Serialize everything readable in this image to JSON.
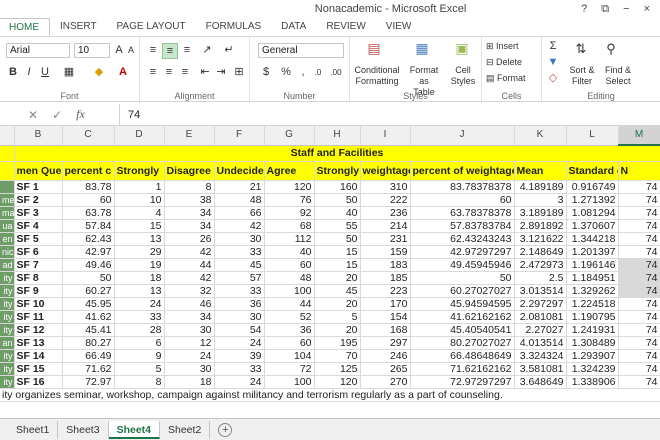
{
  "window": {
    "title": "Nonacademic - Microsoft Excel",
    "controls": [
      "?",
      "⧉",
      "−",
      "×"
    ]
  },
  "tabs": [
    "HOME",
    "INSERT",
    "PAGE LAYOUT",
    "FORMULAS",
    "DATA",
    "REVIEW",
    "VIEW"
  ],
  "ribbon": {
    "font_name": "Arial",
    "font_size": "10",
    "number_format": "General",
    "groups": [
      "Font",
      "Alignment",
      "Number",
      "Styles",
      "Cells",
      "Editing"
    ],
    "styles": {
      "conditional": "Conditional\nFormatting",
      "format_table": "Format as\nTable",
      "cell_styles": "Cell\nStyles"
    },
    "cells": {
      "insert": "Insert",
      "delete": "Delete",
      "format": "Format"
    },
    "editing": {
      "sort": "Sort &\nFilter",
      "find": "Find &\nSelect"
    }
  },
  "formula_bar": {
    "value": "74"
  },
  "columns": [
    "B",
    "C",
    "D",
    "E",
    "F",
    "G",
    "H",
    "I",
    "J",
    "K",
    "L",
    "M"
  ],
  "active_column": "M",
  "title_row": "Staff and Facilities",
  "header_row": [
    "men Question",
    "percent c",
    "Strongly",
    "Disagree",
    "Undecided",
    "Agree",
    "Strongly a",
    "weightage",
    "percent of weightage",
    "Mean",
    "Standard c",
    "N"
  ],
  "rows": [
    {
      "a": "",
      "cells": [
        "SF 1",
        "83.78",
        "1",
        "8",
        "21",
        "120",
        "160",
        "310",
        "83.78378378",
        "4.189189",
        "0.916749",
        "74"
      ]
    },
    {
      "a": "me",
      "cells": [
        "SF 2",
        "60",
        "10",
        "38",
        "48",
        "76",
        "50",
        "222",
        "60",
        "3",
        "1.271392",
        "74"
      ]
    },
    {
      "a": "ma",
      "cells": [
        "SF 3",
        "63.78",
        "4",
        "34",
        "66",
        "92",
        "40",
        "236",
        "63.78378378",
        "3.189189",
        "1.081294",
        "74"
      ]
    },
    {
      "a": "ua",
      "cells": [
        "SF 4",
        "57.84",
        "15",
        "34",
        "42",
        "68",
        "55",
        "214",
        "57.83783784",
        "2.891892",
        "1.370607",
        "74"
      ]
    },
    {
      "a": "en",
      "cells": [
        "SF 5",
        "62.43",
        "13",
        "26",
        "30",
        "112",
        "50",
        "231",
        "62.43243243",
        "3.121622",
        "1.344218",
        "74"
      ]
    },
    {
      "a": "nic",
      "cells": [
        "SF 6",
        "42.97",
        "29",
        "42",
        "33",
        "40",
        "15",
        "159",
        "42.97297297",
        "2.148649",
        "1.201397",
        "74"
      ]
    },
    {
      "a": "ad",
      "cells": [
        "SF 7",
        "49.46",
        "19",
        "44",
        "45",
        "60",
        "15",
        "183",
        "49.45945946",
        "2.472973",
        "1.196146",
        "74"
      ]
    },
    {
      "a": "ity",
      "cells": [
        "SF 8",
        "50",
        "18",
        "42",
        "57",
        "48",
        "20",
        "185",
        "50",
        "2.5",
        "1.184951",
        "74"
      ]
    },
    {
      "a": "ity",
      "cells": [
        "SF 9",
        "60.27",
        "13",
        "32",
        "33",
        "100",
        "45",
        "223",
        "60.27027027",
        "3.013514",
        "1.329262",
        "74"
      ]
    },
    {
      "a": "ity",
      "cells": [
        "SF 10",
        "45.95",
        "24",
        "46",
        "36",
        "44",
        "20",
        "170",
        "45.94594595",
        "2.297297",
        "1.224518",
        "74"
      ]
    },
    {
      "a": "ity",
      "cells": [
        "SF 11",
        "41.62",
        "33",
        "34",
        "30",
        "52",
        "5",
        "154",
        "41.62162162",
        "2.081081",
        "1.190795",
        "74"
      ]
    },
    {
      "a": "ity",
      "cells": [
        "SF 12",
        "45.41",
        "28",
        "30",
        "54",
        "36",
        "20",
        "168",
        "45.40540541",
        "2.27027",
        "1.241931",
        "74"
      ]
    },
    {
      "a": "an",
      "cells": [
        "SF 13",
        "80.27",
        "6",
        "12",
        "24",
        "60",
        "195",
        "297",
        "80.27027027",
        "4.013514",
        "1.308489",
        "74"
      ]
    },
    {
      "a": "ity",
      "cells": [
        "SF 14",
        "66.49",
        "9",
        "24",
        "39",
        "104",
        "70",
        "246",
        "66.48648649",
        "3.324324",
        "1.293907",
        "74"
      ]
    },
    {
      "a": "ity",
      "cells": [
        "SF 15",
        "71.62",
        "5",
        "30",
        "33",
        "72",
        "125",
        "265",
        "71.62162162",
        "3.581081",
        "1.324239",
        "74"
      ]
    },
    {
      "a": "ity",
      "cells": [
        "SF 16",
        "72.97",
        "8",
        "18",
        "24",
        "100",
        "120",
        "270",
        "72.97297297",
        "3.648649",
        "1.338906",
        "74"
      ]
    }
  ],
  "note_row": "ity organizes seminar, workshop, campaign against militancy and terrorism regularly as a part of counseling.",
  "sheets": [
    "Sheet1",
    "Sheet3",
    "Sheet4",
    "Sheet2"
  ],
  "active_sheet": "Sheet4"
}
